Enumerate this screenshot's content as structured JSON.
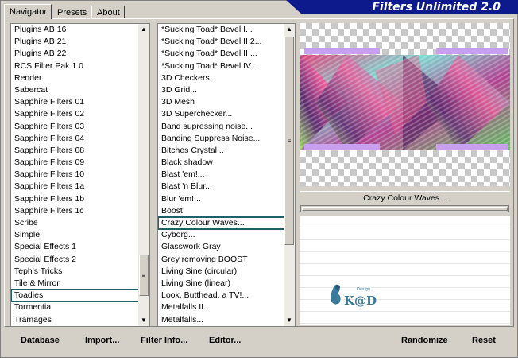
{
  "tabs": [
    {
      "label": "Navigator"
    },
    {
      "label": "Presets"
    },
    {
      "label": "About"
    }
  ],
  "banner": {
    "title": "Filters Unlimited 2.0"
  },
  "categories": [
    "Plugins AB 16",
    "Plugins AB 21",
    "Plugins AB 22",
    "RCS Filter Pak 1.0",
    "Render",
    "Sabercat",
    "Sapphire Filters 01",
    "Sapphire Filters 02",
    "Sapphire Filters 03",
    "Sapphire Filters 04",
    "Sapphire Filters 08",
    "Sapphire Filters 09",
    "Sapphire Filters 10",
    "Sapphire Filters 1a",
    "Sapphire Filters 1b",
    "Sapphire Filters 1c",
    "Scribe",
    "Simple",
    "Special Effects 1",
    "Special Effects 2",
    "Teph's Tricks",
    "Tile & Mirror",
    "Toadies",
    "Tormentia",
    "Tramages"
  ],
  "selected_category": "Toadies",
  "filters": [
    "*Sucking Toad*  Bevel I...",
    "*Sucking Toad*  Bevel II.2...",
    "*Sucking Toad*  Bevel III...",
    "*Sucking Toad*  Bevel IV...",
    "3D Checkers...",
    "3D Grid...",
    "3D Mesh",
    "3D Superchecker...",
    "Band supressing noise...",
    "Banding Suppress Noise...",
    "Bitches Crystal...",
    "Black shadow",
    "Blast 'em!...",
    "Blast 'n Blur...",
    "Blur 'em!...",
    "Boost",
    "Crazy Colour Waves...",
    "Cyborg...",
    "Glasswork Gray",
    "Grey removing BOOST",
    "Living Sine (circular)",
    "Living Sine (linear)",
    "Look, Butthead, a TV!...",
    "Metalfalls II...",
    "Metalfalls..."
  ],
  "selected_filter": "Crazy Colour Waves...",
  "preview": {
    "filter_name": "Crazy Colour Waves..."
  },
  "logo": {
    "text": "K@D",
    "small": "Design"
  },
  "buttons": {
    "database": "Database",
    "import": "Import...",
    "filter_info": "Filter Info...",
    "editor": "Editor...",
    "randomize": "Randomize",
    "reset": "Reset"
  },
  "colors": {
    "banner": "#0c1a8c",
    "highlight": "#1e5f6b"
  }
}
